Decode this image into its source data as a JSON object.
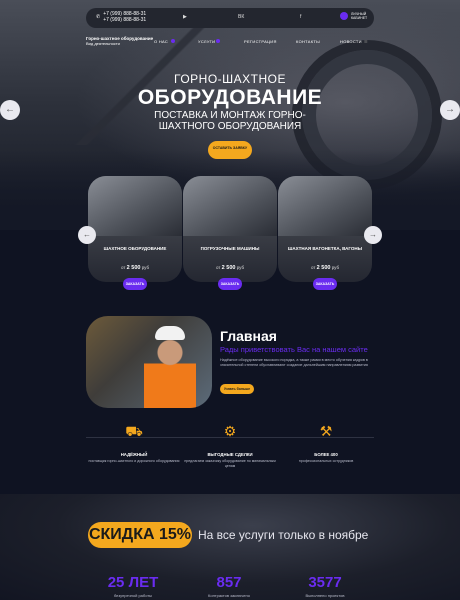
{
  "header": {
    "phone_lines": [
      "+7 (999) 888-88-31",
      "+7 (999) 888-88-31"
    ],
    "social": [
      "▶",
      "ВК",
      "f"
    ],
    "user_label": [
      "ЛИЧНЫЙ",
      "КАБИНЕТ"
    ],
    "logo_title": "Горно-шахтное оборудование",
    "logo_sub": "Вид деятельности"
  },
  "nav": {
    "items": [
      "О НАС",
      "УСЛУГИ",
      "РЕГИСТРАЦИЯ",
      "КОНТАКТЫ",
      "НОВОСТИ"
    ]
  },
  "hero": {
    "title1": "ГОРНО-ШАХТНОЕ",
    "title2": "ОБОРУДОВАНИЕ",
    "subtitle": "ПОСТАВКА И МОНТАЖ ГОРНО-ШАХТНОГО ОБОРУДОВАНИЯ",
    "button": "ОСТАВИТЬ ЗАЯВКУ"
  },
  "cards": [
    {
      "title": "ШАХТНОЕ ОБОРУДОВАНИЕ",
      "price_prefix": "от",
      "price": "2 500",
      "currency": "руб",
      "button": "ЗАКАЗАТЬ"
    },
    {
      "title": "ПОГРУЗОЧНЫЕ МАШИНЫ",
      "price_prefix": "от",
      "price": "2 500",
      "currency": "руб",
      "button": "ЗАКАЗАТЬ"
    },
    {
      "title": "ШАХТНАЯ ВАГОНЕТКА, ВАГОНЫ",
      "price_prefix": "от",
      "price": "2 500",
      "currency": "руб",
      "button": "ЗАКАЗАТЬ"
    }
  ],
  "about": {
    "title": "Главная",
    "welcome": "Рады приветствовать Вас на нашем сайте",
    "text": "Надёжное оборудование высокого порядка, а также рамки в место обучения кадров в значительной степени обуславливают создание дальнейшим направлениям развития",
    "button": "Узнать больше"
  },
  "features": [
    {
      "title": "НАДЁЖНЫЙ",
      "desc": "поставщик горно-шахтного и дорожного оборудования"
    },
    {
      "title": "ВЫГОДНЫЕ СДЕЛКИ",
      "desc": "предлагаем заказчику оборудование по минимальным ценам"
    },
    {
      "title": "БОЛЕЕ 400",
      "desc": "профессиональных сотрудников"
    }
  ],
  "promo": {
    "badge": "СКИДКА 15%",
    "text": "На все услуги только в ноябре"
  },
  "stats": [
    {
      "num": "25 ЛЕТ",
      "label": "безупречной работы"
    },
    {
      "num": "857",
      "label": "Контрактов заключено"
    },
    {
      "num": "3577",
      "label": "Выполнено проектов"
    }
  ],
  "colors": {
    "accent": "#6a2cf0",
    "orange": "#f4a81e",
    "bg": "#0f1322"
  }
}
